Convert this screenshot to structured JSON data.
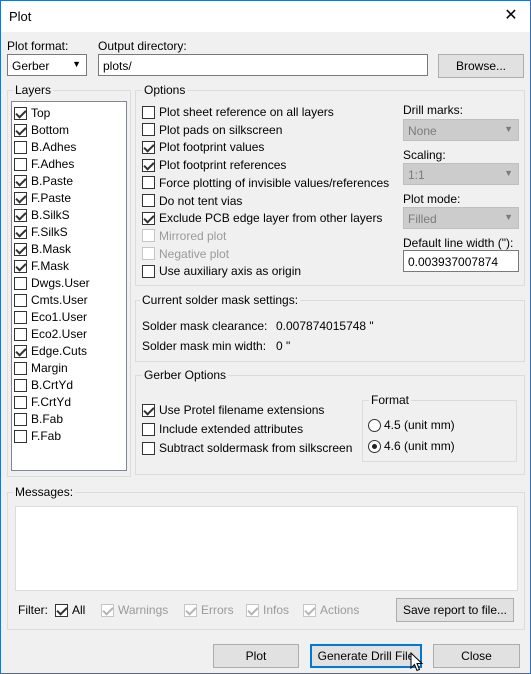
{
  "window": {
    "title": "Plot",
    "close_glyph": "✕"
  },
  "plot_format": {
    "label": "Plot format:",
    "value": "Gerber"
  },
  "output_dir": {
    "label": "Output directory:",
    "value": "plots/",
    "browse": "Browse..."
  },
  "layers": {
    "title": "Layers",
    "items": [
      {
        "label": "Top",
        "checked": true
      },
      {
        "label": "Bottom",
        "checked": true
      },
      {
        "label": "B.Adhes",
        "checked": false
      },
      {
        "label": "F.Adhes",
        "checked": false
      },
      {
        "label": "B.Paste",
        "checked": true
      },
      {
        "label": "F.Paste",
        "checked": true
      },
      {
        "label": "B.SilkS",
        "checked": true
      },
      {
        "label": "F.SilkS",
        "checked": true
      },
      {
        "label": "B.Mask",
        "checked": true
      },
      {
        "label": "F.Mask",
        "checked": true
      },
      {
        "label": "Dwgs.User",
        "checked": false
      },
      {
        "label": "Cmts.User",
        "checked": false
      },
      {
        "label": "Eco1.User",
        "checked": false
      },
      {
        "label": "Eco2.User",
        "checked": false
      },
      {
        "label": "Edge.Cuts",
        "checked": true
      },
      {
        "label": "Margin",
        "checked": false
      },
      {
        "label": "B.CrtYd",
        "checked": false
      },
      {
        "label": "F.CrtYd",
        "checked": false
      },
      {
        "label": "B.Fab",
        "checked": false
      },
      {
        "label": "F.Fab",
        "checked": false
      }
    ]
  },
  "options": {
    "title": "Options",
    "items": [
      {
        "label": "Plot sheet reference on all layers",
        "checked": false,
        "enabled": true
      },
      {
        "label": "Plot pads on silkscreen",
        "checked": false,
        "enabled": true
      },
      {
        "label": "Plot footprint values",
        "checked": true,
        "enabled": true
      },
      {
        "label": "Plot footprint references",
        "checked": true,
        "enabled": true
      },
      {
        "label": "Force plotting of invisible values/references",
        "checked": false,
        "enabled": true
      },
      {
        "label": "Do not tent vias",
        "checked": false,
        "enabled": true
      },
      {
        "label": "Exclude PCB edge layer from other layers",
        "checked": true,
        "enabled": true
      },
      {
        "label": "Mirrored plot",
        "checked": false,
        "enabled": false
      },
      {
        "label": "Negative plot",
        "checked": false,
        "enabled": false
      },
      {
        "label": "Use auxiliary axis as origin",
        "checked": false,
        "enabled": true
      }
    ],
    "drill_marks": {
      "label": "Drill marks:",
      "value": "None"
    },
    "scaling": {
      "label": "Scaling:",
      "value": "1:1"
    },
    "plot_mode": {
      "label": "Plot mode:",
      "value": "Filled"
    },
    "line_width": {
      "label": "Default line width (\"):",
      "value": "0.003937007874"
    }
  },
  "solder_mask": {
    "title": "Current solder mask settings:",
    "clearance_label": "Solder mask clearance:",
    "clearance_value": "0.007874015748 \"",
    "min_width_label": "Solder mask min width:",
    "min_width_value": "0 \""
  },
  "gerber": {
    "title": "Gerber Options",
    "items": [
      {
        "label": "Use Protel filename extensions",
        "checked": true
      },
      {
        "label": "Include extended attributes",
        "checked": false
      },
      {
        "label": "Subtract soldermask from silkscreen",
        "checked": false
      }
    ],
    "format": {
      "title": "Format",
      "options": [
        {
          "label": "4.5 (unit mm)",
          "selected": false
        },
        {
          "label": "4.6 (unit mm)",
          "selected": true
        }
      ]
    }
  },
  "messages": {
    "title": "Messages:",
    "filter_label": "Filter:",
    "filters": [
      {
        "label": "All",
        "checked": true,
        "enabled": true
      },
      {
        "label": "Warnings",
        "checked": true,
        "enabled": false
      },
      {
        "label": "Errors",
        "checked": true,
        "enabled": false
      },
      {
        "label": "Infos",
        "checked": true,
        "enabled": false
      },
      {
        "label": "Actions",
        "checked": true,
        "enabled": false
      }
    ],
    "save_report": "Save report to file..."
  },
  "buttons": {
    "plot": "Plot",
    "drill": "Generate Drill File",
    "close": "Close"
  },
  "colors": {
    "accent": "#0078d7",
    "border": "#2f6fb3"
  }
}
